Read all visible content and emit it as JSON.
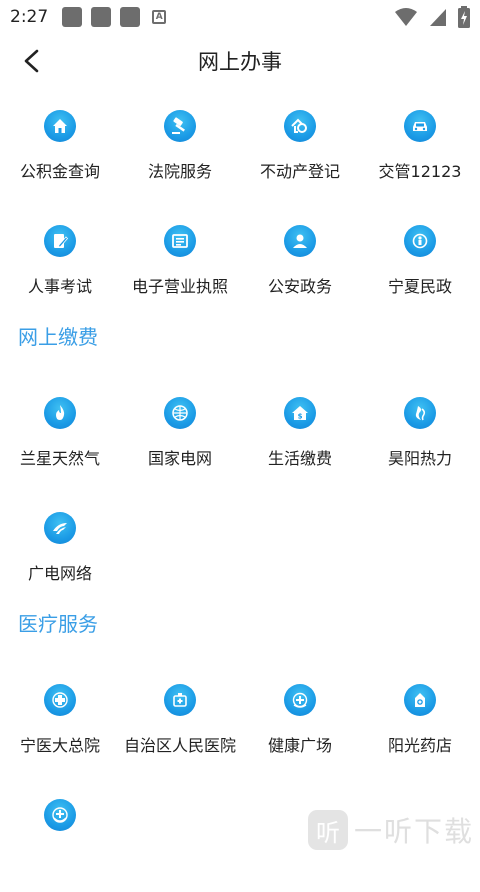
{
  "status_bar": {
    "time": "2:27",
    "a_label": "A"
  },
  "header": {
    "title": "网上办事"
  },
  "sections": [
    {
      "title": "",
      "items": [
        {
          "label": "公积金查询",
          "icon": "house-icon"
        },
        {
          "label": "法院服务",
          "icon": "gavel-icon"
        },
        {
          "label": "不动产登记",
          "icon": "property-key-icon"
        },
        {
          "label": "交管12123",
          "icon": "car-icon"
        },
        {
          "label": "人事考试",
          "icon": "exam-pen-icon"
        },
        {
          "label": "电子营业执照",
          "icon": "license-icon"
        },
        {
          "label": "公安政务",
          "icon": "police-icon"
        },
        {
          "label": "宁夏民政",
          "icon": "civil-affairs-icon"
        }
      ]
    },
    {
      "title": "网上缴费",
      "items": [
        {
          "label": "兰星天然气",
          "icon": "gas-flame-icon"
        },
        {
          "label": "国家电网",
          "icon": "state-grid-icon"
        },
        {
          "label": "生活缴费",
          "icon": "home-payment-icon"
        },
        {
          "label": "昊阳热力",
          "icon": "heat-icon"
        },
        {
          "label": "广电网络",
          "icon": "broadcast-network-icon"
        }
      ]
    },
    {
      "title": "医疗服务",
      "items": [
        {
          "label": "宁医大总院",
          "icon": "medical-cross-icon"
        },
        {
          "label": "自治区人民医院",
          "icon": "hospital-icon"
        },
        {
          "label": "健康广场",
          "icon": "health-square-icon"
        },
        {
          "label": "阳光药店",
          "icon": "pharmacy-icon"
        },
        {
          "label": "",
          "icon": "health-service-icon"
        }
      ]
    }
  ],
  "watermark": {
    "text": "一听下载",
    "logo_char": "听"
  },
  "colors": {
    "accent": "#3a9ee6",
    "icon_blue": "#1b9be6"
  }
}
